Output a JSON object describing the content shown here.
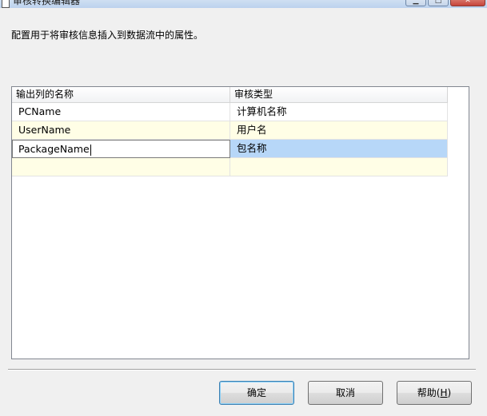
{
  "window": {
    "title": "审核转换编辑器"
  },
  "description": "配置用于将审核信息插入到数据流中的属性。",
  "grid": {
    "columns": [
      "输出列的名称",
      "审核类型"
    ],
    "rows": [
      {
        "output_name": "PCName",
        "audit_type": "计算机名称"
      },
      {
        "output_name": "UserName",
        "audit_type": "用户名"
      },
      {
        "output_name": "PackageName",
        "audit_type": "包名称"
      },
      {
        "output_name": "",
        "audit_type": ""
      }
    ]
  },
  "buttons": {
    "ok": "确定",
    "cancel": "取消",
    "help_prefix": "帮助(",
    "help_key": "H",
    "help_suffix": ")"
  },
  "icons": {
    "window": "window-icon",
    "minimize": "minimize-icon",
    "maximize": "maximize-icon",
    "close": "close-icon"
  },
  "colors": {
    "selected_cell": "#b7d7f8",
    "alt_row": "#fffee6",
    "default_button_border": "#3c7fb1"
  }
}
